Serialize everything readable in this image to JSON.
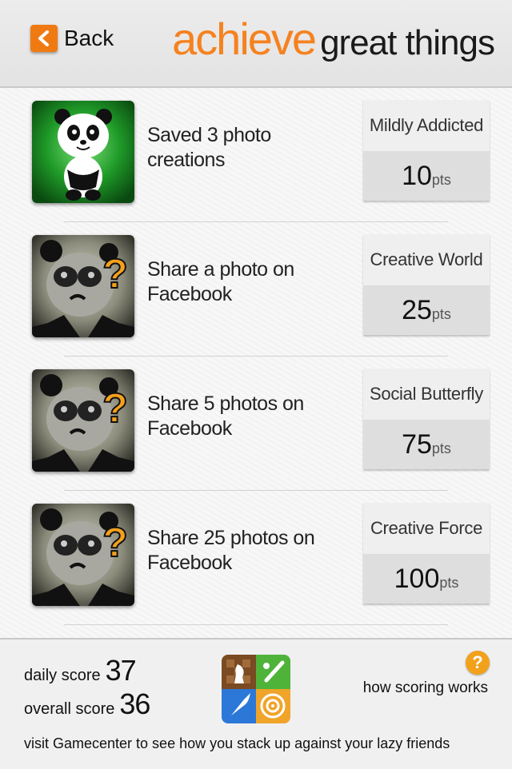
{
  "header": {
    "back_label": "Back",
    "title_accent": "achieve",
    "title_rest": "great things",
    "accent_color": "#f58220"
  },
  "achievements": [
    {
      "description": "Saved 3 photo creations",
      "name": "Mildly Addicted",
      "points": "10",
      "points_unit": "pts",
      "unlocked": true,
      "icon": "happy-panda-icon"
    },
    {
      "description": "Share a photo on Facebook",
      "name": "Creative World",
      "points": "25",
      "points_unit": "pts",
      "unlocked": false,
      "icon": "locked-panda-icon"
    },
    {
      "description": "Share 5 photos on Facebook",
      "name": "Social Butterfly",
      "points": "75",
      "points_unit": "pts",
      "unlocked": false,
      "icon": "locked-panda-icon"
    },
    {
      "description": "Share 25 photos on Facebook",
      "name": "Creative Force",
      "points": "100",
      "points_unit": "pts",
      "unlocked": false,
      "icon": "locked-panda-icon"
    }
  ],
  "footer": {
    "daily_label": "daily score",
    "daily_score": "37",
    "overall_label": "overall score",
    "overall_score": "36",
    "how_scoring_label": "how scoring works",
    "visit_text": "visit Gamecenter to see how you stack up against your lazy friends",
    "icons": [
      "gamecenter-icon",
      "help-icon"
    ]
  }
}
